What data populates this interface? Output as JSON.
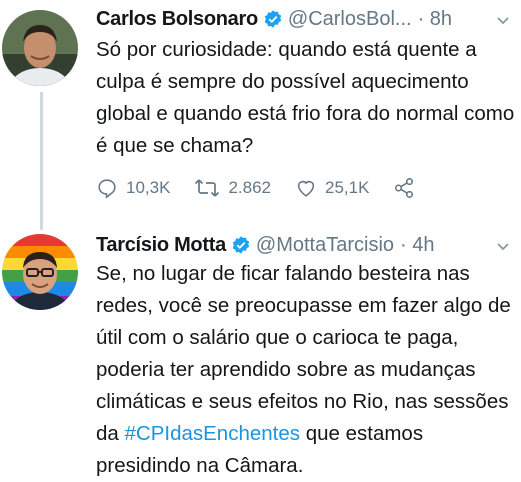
{
  "tweets": [
    {
      "name": "Carlos Bolsonaro",
      "handle": "@CarlosBol...",
      "time": "· 8h",
      "text": "Só por curiosidade: quando está quente a culpa é sempre do possível aquecimento global e quando está frio fora do normal como é que se chama?",
      "replies": "10,3K",
      "retweets": "2.862",
      "likes": "25,1K"
    },
    {
      "name": "Tarcísio Motta",
      "handle": "@MottaTarcisio",
      "time": "· 4h",
      "text_before": "Se, no lugar de ficar falando besteira nas redes, você se preocupasse em fazer algo de útil com o salário que o carioca te paga, poderia ter aprendido sobre as mudanças climáticas e seus efeitos no Rio, nas sessões da ",
      "hashtag": "#CPIdasEnchentes",
      "text_after": " que estamos presidindo na Câmara."
    }
  ],
  "colors": {
    "link": "#1b95e0",
    "verified": "#1da1f2",
    "muted": "#657786",
    "thread": "#cfd9de"
  },
  "icons": [
    "verified-badge-icon",
    "chevron-down-icon",
    "reply-icon",
    "retweet-icon",
    "like-icon",
    "share-icon"
  ]
}
